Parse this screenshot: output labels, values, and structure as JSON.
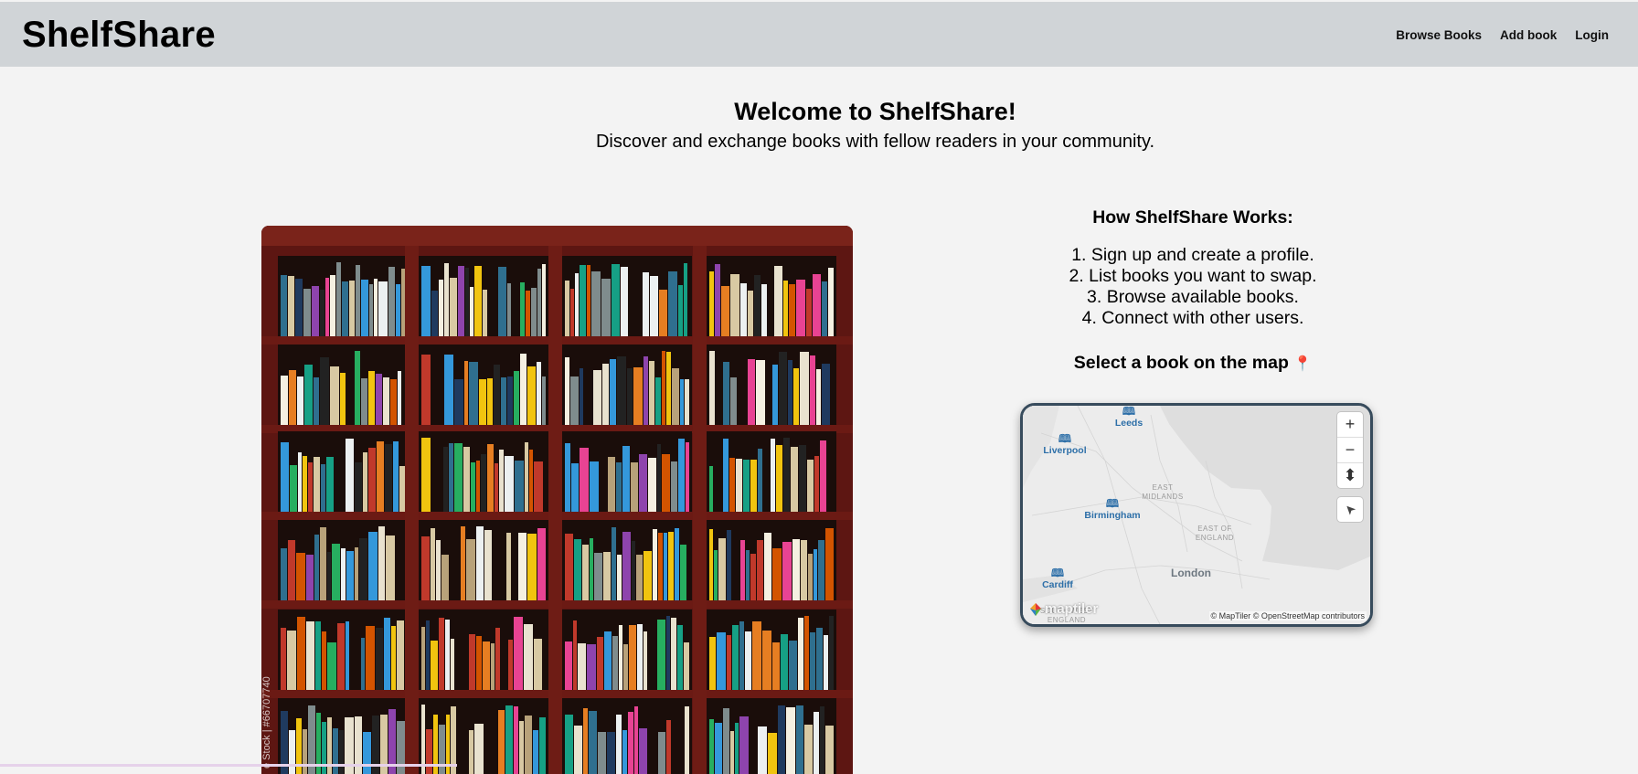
{
  "header": {
    "brand": "ShelfShare",
    "nav": [
      "Browse Books",
      "Add book",
      "Login"
    ]
  },
  "hero": {
    "title": "Welcome to ShelfShare!",
    "subtitle": "Discover and exchange books with fellow readers in your community."
  },
  "photo": {
    "credit": "e Stock | #66707740"
  },
  "how": {
    "title": "How ShelfShare Works:",
    "steps": [
      "1. Sign up and create a profile.",
      "2. List books you want to swap.",
      "3. Browse available books.",
      "4. Connect with other users."
    ]
  },
  "map": {
    "title": "Select a book on the map",
    "pin_glyph": "📍",
    "cities": [
      "Leeds",
      "Liverpool",
      "Birmingham",
      "Cardiff"
    ],
    "book_glyph": "🕮",
    "london": "London",
    "regions": [
      "EAST MIDLANDS",
      "EAST OF ENGLAND",
      "SOUTH WEST ENGLAND"
    ],
    "controls": {
      "zoom_in": "+",
      "zoom_out": "−",
      "compass": "⬍",
      "locate": "➤"
    },
    "logo": "maptiler",
    "attribution": "© MapTiler © OpenStreetMap contributors"
  },
  "colors": {
    "header_bg": "#d0d4d7",
    "page_bg": "#f3f3f3",
    "map_border": "#374b5c",
    "city_blue": "#2d6fa8",
    "shelf_wood": "#5a1410"
  }
}
